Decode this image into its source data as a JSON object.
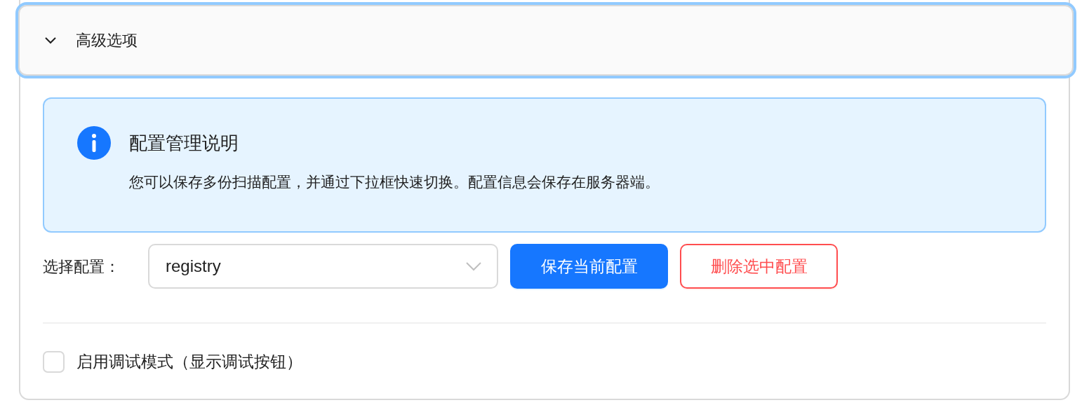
{
  "panel": {
    "title": "高级选项",
    "expanded": true,
    "focused": true
  },
  "alert": {
    "title": "配置管理说明",
    "description": "您可以保存多份扫描配置，并通过下拉框快速切换。配置信息会保存在服务器端。"
  },
  "config": {
    "label": "选择配置：",
    "value": "registry",
    "buttons": [
      {
        "label": "保存当前配置",
        "kind": "primary"
      },
      {
        "label": "删除选中配置",
        "kind": "danger"
      }
    ]
  },
  "debug": {
    "label": "启用调试模式（显示调试按钮）",
    "checked": false
  }
}
